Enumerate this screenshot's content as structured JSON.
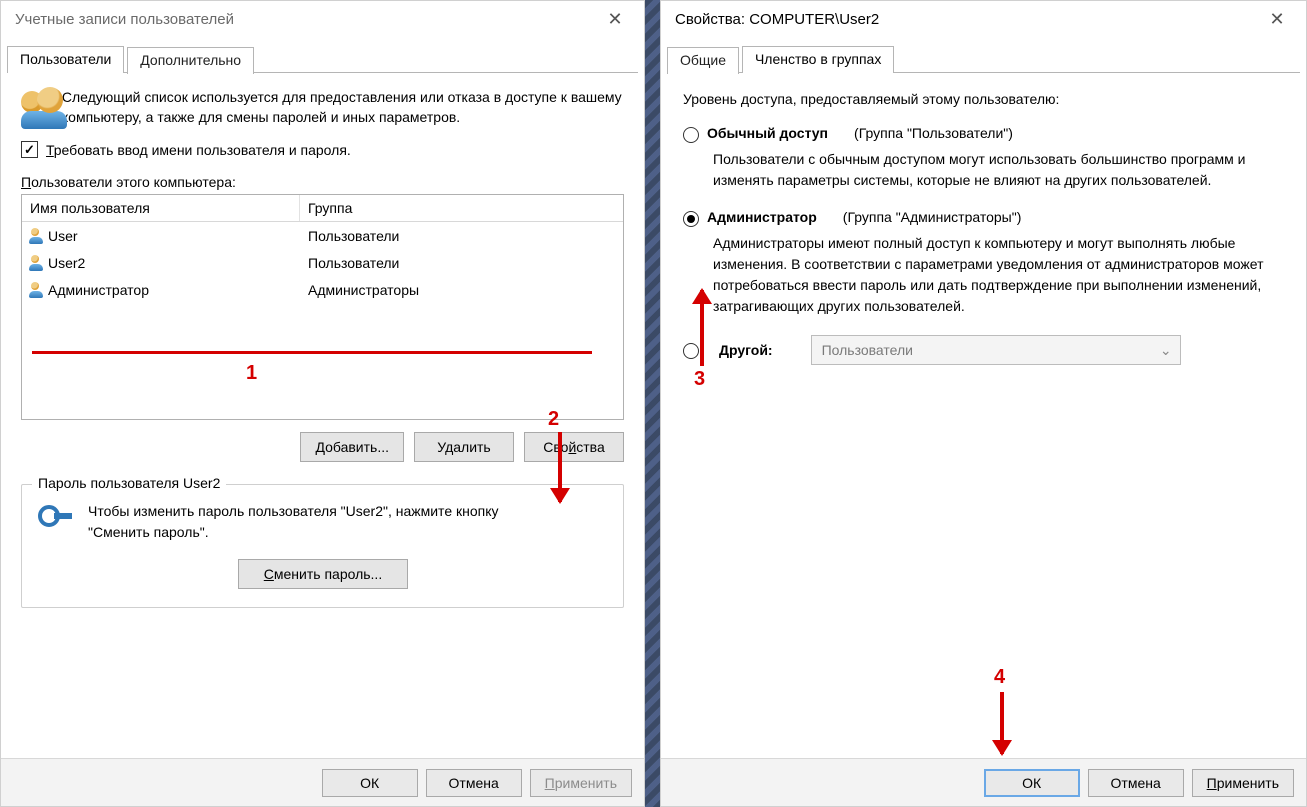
{
  "left": {
    "title": "Учетные записи пользователей",
    "tabs": {
      "users": "Пользователи",
      "advanced": "Дополнительно"
    },
    "intro": "Следующий список используется для предоставления или отказа в доступе к вашему компьютеру, а также для смены паролей и иных параметров.",
    "require_login_label": "Требовать ввод имени пользователя и пароля.",
    "require_login_checked": true,
    "list_label": "Пользователи этого компьютера:",
    "columns": {
      "name": "Имя пользователя",
      "group": "Группа"
    },
    "rows": [
      {
        "name": "User",
        "group": "Пользователи"
      },
      {
        "name": "User2",
        "group": "Пользователи"
      },
      {
        "name": "Администратор",
        "group": "Администраторы"
      }
    ],
    "buttons": {
      "add": "Добавить...",
      "remove": "Удалить",
      "properties": "Свойства"
    },
    "pw_group_title": "Пароль пользователя User2",
    "pw_hint": "Чтобы изменить пароль пользователя \"User2\", нажмите кнопку \"Сменить пароль\".",
    "pw_button": "Сменить пароль...",
    "bottom": {
      "ok": "ОК",
      "cancel": "Отмена",
      "apply": "Применить"
    }
  },
  "right": {
    "title": "Свойства: COMPUTER\\User2",
    "tabs": {
      "general": "Общие",
      "membership": "Членство в группах"
    },
    "hint": "Уровень доступа, предоставляемый этому пользователю:",
    "standard": {
      "label": "Обычный доступ",
      "note": "(Группа \"Пользователи\")",
      "desc": "Пользователи с обычным доступом могут использовать большинство программ и изменять параметры системы, которые не влияют на других пользователей."
    },
    "admin": {
      "label": "Администратор",
      "note": "(Группа \"Администраторы\")",
      "desc": "Администраторы имеют полный доступ к компьютеру и могут выполнять любые изменения. В соответствии с параметрами уведомления от администраторов может потребоваться ввести пароль или дать подтверждение при выполнении изменений, затрагивающих других пользователей."
    },
    "other": {
      "label": "Другой:",
      "combo": "Пользователи"
    },
    "selected": "admin",
    "bottom": {
      "ok": "ОК",
      "cancel": "Отмена",
      "apply": "Применить"
    }
  },
  "annotations": {
    "n1": "1",
    "n2": "2",
    "n3": "3",
    "n4": "4"
  }
}
